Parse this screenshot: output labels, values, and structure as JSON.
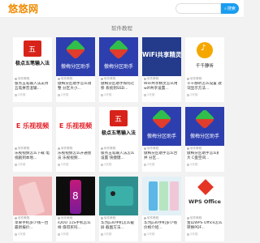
{
  "header": {
    "logo": "悠悠网",
    "search_placeholder": "",
    "search_button": "搜索"
  },
  "section_title": "软件教程",
  "cards": [
    {
      "thumb": "wubi",
      "thumb_text": "极点五笔输入法",
      "tag": "软件教程",
      "title": "极点五笔输入法支持 五笔拼音混输...",
      "foot": "2天前"
    },
    {
      "thumb": "yuyou",
      "thumb_text": "傲梅分区助手",
      "tag": "软件教程",
      "title": "傲梅分区助手怎么调整 分区大小...",
      "foot": "2天前"
    },
    {
      "thumb": "yuyou",
      "thumb_text": "傲梅分区助手",
      "tag": "软件教程",
      "title": "傲梅分区助手如何迁移 系统到SSD...",
      "foot": "2天前"
    },
    {
      "thumb": "wifi",
      "thumb_text": "WiFi共享精灵",
      "tag": "软件教程",
      "title": "WiFi共享精灵怎么用 wifi共享设置...",
      "foot": "2天前"
    },
    {
      "thumb": "qianqian",
      "thumb_text": "千千静听",
      "tag": "软件教程",
      "title": "千千静听怎么设置 歌词显示方法...",
      "foot": "2天前"
    },
    {
      "thumb": "leshi",
      "thumb_text": "E 乐视视频",
      "tag": "软件教程",
      "title": "乐视视频怎么下载 电视剧到本地...",
      "foot": "2天前"
    },
    {
      "thumb": "leshi",
      "thumb_text": "E 乐视视频",
      "tag": "软件教程",
      "title": "乐视视频怎么开通会员 乐视视频...",
      "foot": "2天前"
    },
    {
      "thumb": "wubi",
      "thumb_text": "极点五笔输入法",
      "tag": "软件教程",
      "title": "极点五笔输入法怎么设置 快捷键...",
      "foot": "2天前"
    },
    {
      "thumb": "yuyou",
      "thumb_text": "傲梅分区助手",
      "tag": "软件教程",
      "title": "傲梅分区助手怎么合并 分区...",
      "foot": "2天前"
    },
    {
      "thumb": "yuyou",
      "thumb_text": "傲梅分区助手",
      "tag": "软件教程",
      "title": "傲梅分区助手怎么扩大 C盘空间...",
      "foot": "2天前"
    },
    {
      "thumb": "phone-pink",
      "thumb_text": "",
      "tag": "软件教程",
      "title": "苹果手机多少钱一台 最新报价...",
      "foot": "2天前"
    },
    {
      "thumb": "iqoo",
      "thumb_text": "",
      "tag": "软件教程",
      "title": "iQOO 11S手机怎么样 值得买吗...",
      "foot": "2天前"
    },
    {
      "thumb": "teal",
      "thumb_text": "",
      "tag": "软件教程",
      "title": "华为p30手机怎么截屏 截图方法...",
      "foot": "2天前"
    },
    {
      "thumb": "phones",
      "thumb_text": "",
      "tag": "软件教程",
      "title": "华为p30手机多少钱 价格介绍...",
      "foot": "2天前"
    },
    {
      "thumb": "wps",
      "thumb_text": "WPS Office",
      "tag": "软件教程",
      "title": "金山WPS Office怎么 转换PDF...",
      "foot": "2天前"
    }
  ]
}
